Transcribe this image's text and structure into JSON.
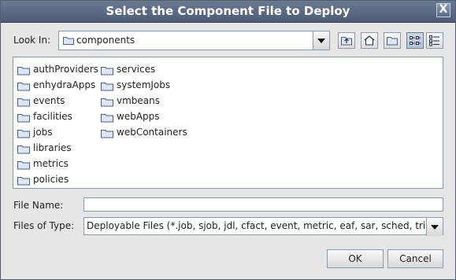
{
  "window": {
    "title": "Select the Component File to Deploy",
    "close_glyph": "X"
  },
  "lookin": {
    "label": "Look In:",
    "value": "components"
  },
  "toolbar": {
    "buttons": [
      {
        "name": "up-one-level-button",
        "icon": "folder-up-icon"
      },
      {
        "name": "home-button",
        "icon": "home-icon"
      },
      {
        "name": "new-folder-button",
        "icon": "new-folder-icon"
      },
      {
        "name": "list-view-button",
        "icon": "list-view-icon",
        "selected": true
      },
      {
        "name": "details-view-button",
        "icon": "details-view-icon",
        "selected": false
      }
    ]
  },
  "files": {
    "column1": [
      "authProviders",
      "enhydraApps",
      "events",
      "facilities",
      "jobs",
      "libraries",
      "metrics",
      "policies"
    ],
    "column2": [
      "services",
      "systemJobs",
      "vmbeans",
      "webApps",
      "webContainers"
    ]
  },
  "filename": {
    "label": "File Name:",
    "value": ""
  },
  "filetype": {
    "label": "Files of Type:",
    "value": "Deployable Files (*.job, sjob, jdl, cfact, event, metric, eaf, sar, sched, trig)"
  },
  "actions": {
    "ok": "OK",
    "cancel": "Cancel"
  },
  "colors": {
    "titlebar": "#5a6883",
    "dialog_bg": "#e6e6e6",
    "folder_fill": "#dfe6f2",
    "folder_stroke": "#4b5d7d"
  }
}
